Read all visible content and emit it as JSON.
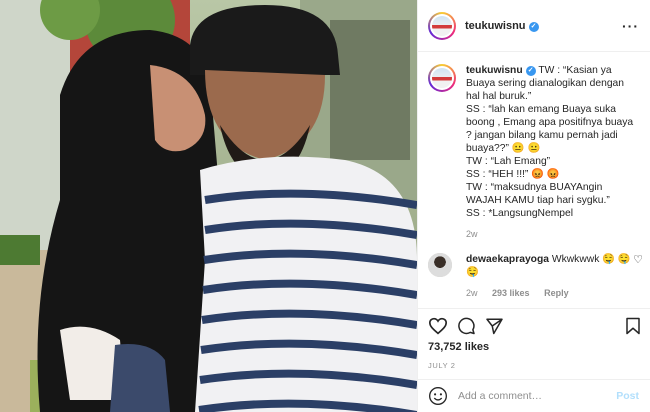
{
  "post": {
    "username": "teukuwisnu",
    "verified": true
  },
  "caption": {
    "username": "teukuwisnu",
    "lines": [
      "TW : “Kasian ya Buaya sering dianalogikan dengan hal hal buruk.”",
      "SS : “lah kan emang Buaya suka boong , Emang apa positifnya buaya ? jangan bilang kamu pernah jadi buaya??” 😐 😐",
      "TW : “Lah Emang”",
      "SS : “HEH !!!” 😡 😡",
      "TW : “maksudnya BUAYAngin WAJAH KAMU tiap hari sygku.”",
      "SS : *LangsungNempel"
    ],
    "time": "2w"
  },
  "reply": {
    "username": "dewaekaprayoga",
    "text": "Wkwkwwk 🤤 🤤 🤤",
    "time": "2w",
    "likes": "293 likes",
    "reply_label": "Reply"
  },
  "actions": {
    "icons": [
      "heart-icon",
      "comment-icon",
      "share-icon",
      "bookmark-icon"
    ],
    "likes": "73,752 likes",
    "date": "JULY 2"
  },
  "add_comment": {
    "placeholder": "Add a comment…",
    "post_label": "Post"
  },
  "colors": {
    "verified_blue": "#3897f0",
    "post_button": "#b2dffc",
    "muted_text": "#8e8e8e",
    "divider": "#efefef"
  }
}
